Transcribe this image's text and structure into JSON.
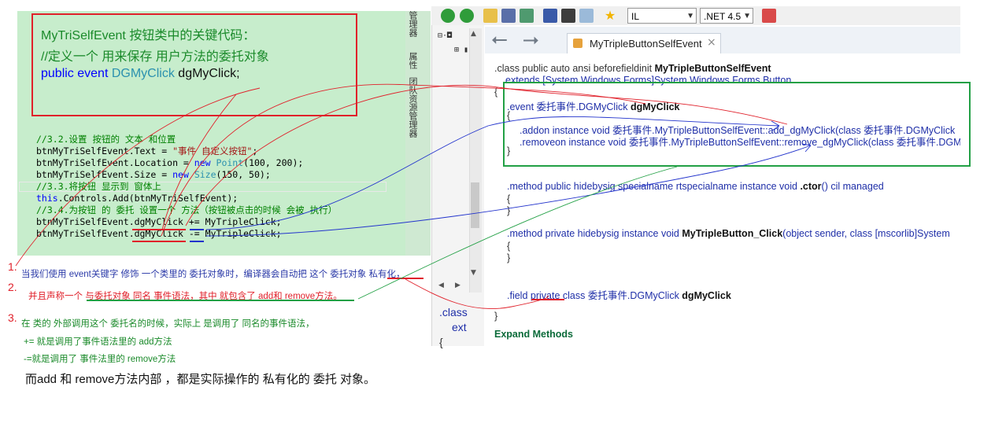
{
  "left_panel": {
    "box_lines": [
      "MyTriSelfEvent 按钮类中的关键代码：",
      "//定义一个 用来保存 用户方法的委托对象"
    ],
    "box_code": {
      "kw": "public event",
      "type": "DGMyClick",
      "name": "dgMyClick;"
    },
    "code": {
      "comment1": "//3.2.设置 按钮的 文本 和位置",
      "text_prefix": "btnMyTriSelfEvent.Text = ",
      "text_value": "\"事件 自定义按钮\"",
      "text_suffix": ";",
      "loc_prefix": "btnMyTriSelfEvent.Location = ",
      "loc_kw": "new",
      "loc_type": "Point",
      "loc_args": "(100, 200);",
      "size_prefix": "btnMyTriSelfEvent.Size = ",
      "size_kw": "new",
      "size_type": "Size",
      "size_args": "(150, 50);",
      "comment2": "//3.3.将按钮 显示到 窗体上",
      "add_kw": "this",
      "add_rest": ".Controls.Add(btnMyTriSelfEvent);",
      "comment3": "//3.4.为按钮 的 委托 设置一个 方法（按钮被点击的时候 会被 执行）",
      "line_plus": "btnMyTriSelfEvent.dgMyClick += MyTripleClick;",
      "line_minus": "btnMyTriSelfEvent.dgMyClick -= MyTripleClick;"
    },
    "vertical_tabs": [
      "管理器",
      "属性",
      "团队资源管理器"
    ]
  },
  "notes": {
    "n1_num": "1.",
    "n1_text": "当我们使用 event关键字 修饰 一个类里的 委托对象时，编译器会自动把 这个 委托对象 私有化，",
    "n2_num": "2.",
    "n2_text": "并且声称一个 与委托对象 同名 事件语法，其中 就包含了 add和 remove方法。",
    "n3_num": "3.",
    "n3_text": "在 类的 外部调用这个 委托名的时候，实际上 是调用了 同名的事件语法，",
    "n3_plus": "+= 就是调用了事件语法里的 add方法",
    "n3_minus": "-=就是调用了 事件法里的 remove方法",
    "summary": "而add 和 remove方法内部 ，都是实际操作的 私有化的 委托 对象。"
  },
  "toolbar": {
    "language": "IL",
    "framework": ".NET 4.5"
  },
  "tab": {
    "title": "MyTripleButtonSelfEvent",
    "close": "×"
  },
  "tree_peek": {
    "class_kw": ".class",
    "ext_kw": "ext",
    "brace": "{"
  },
  "il": {
    "class_decl": ".class public auto ansi beforefieldinit ",
    "class_name": "MyTripleButtonSelfEvent",
    "extends": "extends [System.Windows.Forms]System.Windows.Forms.Button",
    "open_brace": "{",
    "event_decl": ".event 委托事件.DGMyClick ",
    "event_name": "dgMyClick",
    "event_open": "{",
    "addon": ".addon instance void 委托事件.MyTripleButtonSelfEvent::add_dgMyClick(class 委托事件.DGMyClick",
    "removeon": ".removeon instance void 委托事件.MyTripleButtonSelfEvent::remove_dgMyClick(class 委托事件.DGM",
    "event_close": "}",
    "ctor_decl": ".method public hidebysig specialname rtspecialname instance void ",
    "ctor_name": ".ctor",
    "ctor_rest": "() cil managed",
    "ctor_open": "{",
    "ctor_close": "}",
    "click_decl": ".method private hidebysig instance void ",
    "click_name": "MyTripleButton_Click",
    "click_rest": "(object sender, class [mscorlib]System",
    "click_open": "{",
    "click_close": "}",
    "field_prefix": ".field ",
    "field_private": "private",
    "field_rest": " class 委托事件.DGMyClick ",
    "field_name": "dgMyClick",
    "close_brace": "}",
    "expand": "Expand Methods"
  },
  "colors": {
    "code_bg": "#c7edcc",
    "red_box": "#e0202a",
    "green_box": "#22a045",
    "blue_line": "#2233cc"
  }
}
